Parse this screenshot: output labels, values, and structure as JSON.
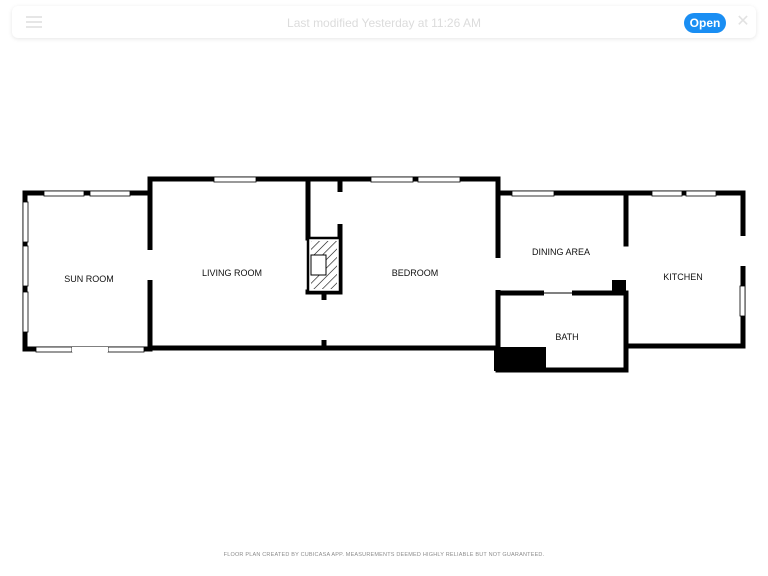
{
  "header": {
    "document_title": "",
    "modified_text": "Last modified Yesterday at 11:26 AM",
    "open_button_label": "Open",
    "close_icon": "close-icon",
    "menu_icon": "menu-icon"
  },
  "floor_plan": {
    "rooms": {
      "sun_room": "SUN ROOM",
      "living_room": "LIVING ROOM",
      "bedroom": "BEDROOM",
      "dining_area": "DINING AREA",
      "kitchen": "KITCHEN",
      "bath": "BATH"
    }
  },
  "footer": {
    "disclaimer": "FLOOR PLAN CREATED BY CUBICASA APP. MEASUREMENTS DEEMED HIGHLY RELIABLE BUT NOT GUARANTEED."
  },
  "colors": {
    "accent": "#1a8ef3",
    "wall": "#000000",
    "background": "#ffffff"
  }
}
